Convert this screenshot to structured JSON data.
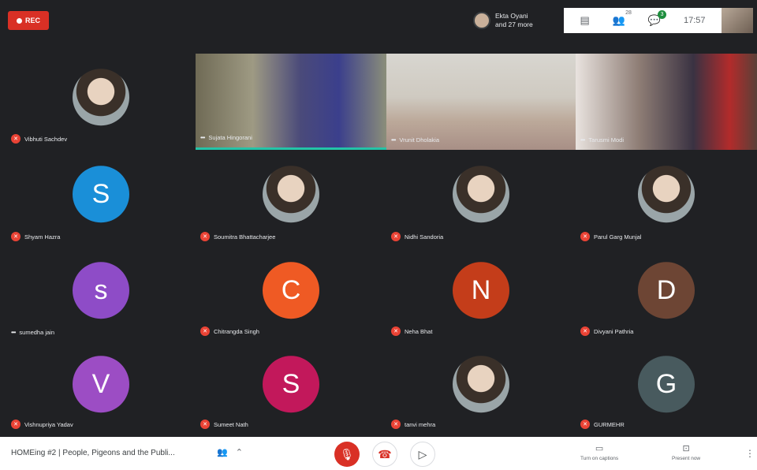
{
  "topbar": {
    "rec_label": "REC",
    "presenter_line1": "Ekta Oyani",
    "presenter_line2": "and 27 more",
    "people_count": "28",
    "chat_badge": "3",
    "clock": "17:57"
  },
  "participants": [
    {
      "name": "Vibhuti Sachdev",
      "kind": "photo",
      "mic": "off"
    },
    {
      "name": "Sujata Hingorani",
      "kind": "video",
      "mic": "on"
    },
    {
      "name": "Vrunit Dholakia",
      "kind": "video",
      "mic": "on"
    },
    {
      "name": "Tarusmi Modi",
      "kind": "video",
      "mic": "on"
    },
    {
      "name": "Shyam Hazra",
      "kind": "letter",
      "letter": "S",
      "color": "#1a8fd8",
      "mic": "off"
    },
    {
      "name": "Soumitra Bhattacharjee",
      "kind": "photo",
      "mic": "off"
    },
    {
      "name": "Nidhi Sandoria",
      "kind": "photo",
      "mic": "off"
    },
    {
      "name": "Parul Garg Munjal",
      "kind": "photo",
      "mic": "off"
    },
    {
      "name": "sumedha jain",
      "kind": "letter",
      "letter": "s",
      "color": "#8e4cc7",
      "mic": "on"
    },
    {
      "name": "Chitrangda Singh",
      "kind": "letter",
      "letter": "C",
      "color": "#ef5a24",
      "mic": "off"
    },
    {
      "name": "Neha Bhat",
      "kind": "letter",
      "letter": "N",
      "color": "#c43d1a",
      "mic": "off"
    },
    {
      "name": "Divyani Pathria",
      "kind": "letter",
      "letter": "D",
      "color": "#6d4534",
      "mic": "off"
    },
    {
      "name": "Vishnupriya Yadav",
      "kind": "letter",
      "letter": "V",
      "color": "#9c4dc4",
      "mic": "off"
    },
    {
      "name": "Sumeet Nath",
      "kind": "letter",
      "letter": "S",
      "color": "#c2185b",
      "mic": "off"
    },
    {
      "name": "tanvi mehra",
      "kind": "photo",
      "mic": "off"
    },
    {
      "name": "GURMEHR",
      "kind": "letter",
      "letter": "G",
      "color": "#485a5e",
      "mic": "off"
    }
  ],
  "bottombar": {
    "meeting_title": "HOMEing #2 | People, Pigeons and the Publi...",
    "captions_label": "Turn on captions",
    "present_label": "Present now"
  }
}
